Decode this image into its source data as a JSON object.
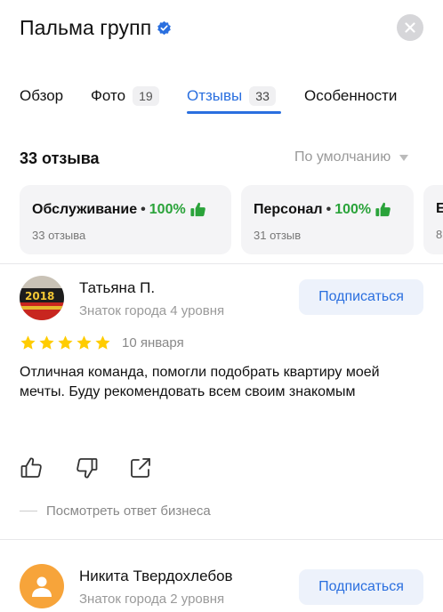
{
  "header": {
    "title": "Пальма групп",
    "verified_icon": "verified-check-icon",
    "close_icon": "close-icon"
  },
  "tabs": [
    {
      "label": "Обзор",
      "count": ""
    },
    {
      "label": "Фото",
      "count": "19"
    },
    {
      "label": "Отзывы",
      "count": "33",
      "active": true
    },
    {
      "label": "Особенности",
      "count": ""
    }
  ],
  "reviews": {
    "total_label": "33 отзыва",
    "sort_label": "По умолчанию",
    "aspects": [
      {
        "name": "Обслуживание",
        "percent": "100%",
        "sub": "33 отзыва"
      },
      {
        "name": "Персонал",
        "percent": "100%",
        "sub": "31 отзыв"
      },
      {
        "name": "Е",
        "percent": "",
        "sub": "8"
      }
    ],
    "items": [
      {
        "author": "Татьяна П.",
        "level": "Знаток города 4 уровня",
        "subscribe_label": "Подписаться",
        "rating": 5,
        "date": "10 января",
        "text": "Отличная команда, помогли подобрать квартиру моей мечты. Буду рекомендовать всем своим знакомым",
        "business_reply_label": "Посмотреть ответ бизнеса"
      },
      {
        "author": "Никита Твердохлебов",
        "level": "Знаток города 2 уровня",
        "subscribe_label": "Подписаться"
      }
    ]
  },
  "colors": {
    "accent": "#2a6fdf",
    "positive": "#2aa33a",
    "star": "#ffcc00",
    "avatar_orange": "#f7a43a"
  }
}
